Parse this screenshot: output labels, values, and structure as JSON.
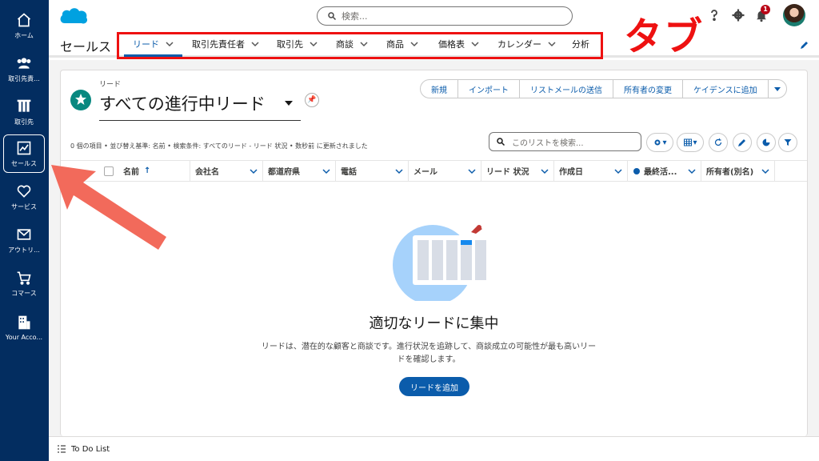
{
  "rail": {
    "items": [
      {
        "label": "ホーム",
        "icon": "home-icon"
      },
      {
        "label": "取引先責...",
        "icon": "contacts-icon"
      },
      {
        "label": "取引先",
        "icon": "building-icon"
      },
      {
        "label": "セールス",
        "icon": "chart-icon"
      },
      {
        "label": "サービス",
        "icon": "heart-icon"
      },
      {
        "label": "アウトリ...",
        "icon": "mail-icon"
      },
      {
        "label": "コマース",
        "icon": "cart-icon"
      },
      {
        "label": "Your Acco...",
        "icon": "office-icon"
      }
    ]
  },
  "header": {
    "search_placeholder": "検索...",
    "notification_count": "1",
    "colors": {
      "rail": "#032d60",
      "brand": "#0b5cab",
      "accent_red": "#ee1111",
      "logo": "#00a1e0"
    }
  },
  "nav": {
    "app_name": "セールス",
    "tabs": [
      {
        "label": "リード",
        "chevron": true
      },
      {
        "label": "取引先責任者",
        "chevron": true
      },
      {
        "label": "取引先",
        "chevron": true
      },
      {
        "label": "商談",
        "chevron": true
      },
      {
        "label": "商品",
        "chevron": true
      },
      {
        "label": "価格表",
        "chevron": true
      },
      {
        "label": "カレンダー",
        "chevron": true
      },
      {
        "label": "分析",
        "chevron": false
      }
    ],
    "annotation": "タブ"
  },
  "list": {
    "object_label": "リード",
    "view_name": "すべての進行中リード",
    "buttons": [
      "新規",
      "インポート",
      "リストメールの送信",
      "所有者の変更",
      "ケイデンスに追加"
    ],
    "meta": "0 個の項目 • 並び替え基準: 名前 • 検索条件: すべてのリード - リード 状況 • 数秒前 に更新されました",
    "search_placeholder": "このリストを検索...",
    "columns": [
      "名前",
      "会社名",
      "都道府県",
      "電話",
      "メール",
      "リード 状況",
      "作成日",
      "最終活...",
      "所有者(別名)"
    ],
    "sort_indicator": "↑"
  },
  "empty_state": {
    "title": "適切なリードに集中",
    "description": "リードは、潜在的な顧客と商談です。進行状況を追跡して、商談成立の可能性が最も高いリードを確認します。",
    "button": "リードを追加"
  },
  "utility": {
    "label": "To Do List"
  }
}
